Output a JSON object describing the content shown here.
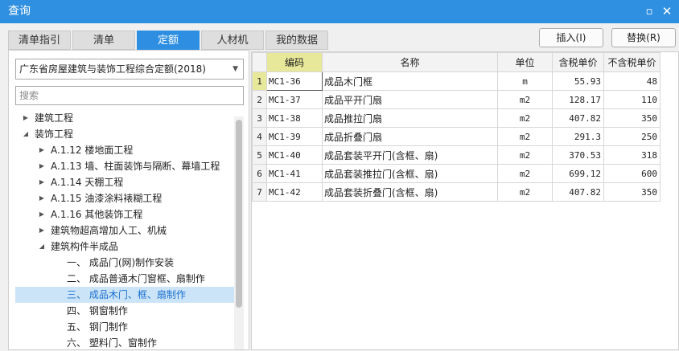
{
  "window": {
    "title": "查询",
    "maximize_glyph": "▫",
    "close_glyph": "✕"
  },
  "tabs": [
    {
      "label": "清单指引",
      "active": false
    },
    {
      "label": "清单",
      "active": false
    },
    {
      "label": "定额",
      "active": true
    },
    {
      "label": "人材机",
      "active": false
    },
    {
      "label": "我的数据",
      "active": false
    }
  ],
  "buttons": {
    "insert": "插入(I)",
    "replace": "替换(R)"
  },
  "library_select": {
    "value": "广东省房屋建筑与装饰工程综合定额(2018)"
  },
  "search": {
    "placeholder": "搜索"
  },
  "tree": [
    {
      "label": "建筑工程",
      "caret": "▶",
      "level": 0
    },
    {
      "label": "装饰工程",
      "caret": "◢",
      "level": 0
    },
    {
      "label": "A.1.12 楼地面工程",
      "caret": "▶",
      "level": 1
    },
    {
      "label": "A.1.13 墙、柱面装饰与隔断、幕墙工程",
      "caret": "▶",
      "level": 1
    },
    {
      "label": "A.1.14 天棚工程",
      "caret": "▶",
      "level": 1
    },
    {
      "label": "A.1.15 油漆涂料裱糊工程",
      "caret": "▶",
      "level": 1
    },
    {
      "label": "A.1.16 其他装饰工程",
      "caret": "▶",
      "level": 1
    },
    {
      "label": "建筑物超高增加人工、机械",
      "caret": "▶",
      "level": 1
    },
    {
      "label": "建筑构件半成品",
      "caret": "◢",
      "level": 1
    },
    {
      "label": "一、 成品门(网)制作安装",
      "caret": "",
      "level": 2
    },
    {
      "label": "二、 成品普通木门窗框、扇制作",
      "caret": "",
      "level": 2
    },
    {
      "label": "三、 成品木门、框、扇制作",
      "caret": "",
      "level": 2,
      "selected": true
    },
    {
      "label": "四、 钢窗制作",
      "caret": "",
      "level": 2
    },
    {
      "label": "五、 钢门制作",
      "caret": "",
      "level": 2
    },
    {
      "label": "六、 塑料门、窗制作",
      "caret": "",
      "level": 2
    }
  ],
  "table": {
    "headers": [
      "",
      "编码",
      "名称",
      "单位",
      "含税单价",
      "不含税单价"
    ],
    "rows": [
      {
        "n": "1",
        "code": "MC1-36",
        "name": "成品木门框",
        "unit": "m",
        "price_tax": "55.93",
        "price_notax": "48"
      },
      {
        "n": "2",
        "code": "MC1-37",
        "name": "成品平开门扇",
        "unit": "m2",
        "price_tax": "128.17",
        "price_notax": "110"
      },
      {
        "n": "3",
        "code": "MC1-38",
        "name": "成品推拉门扇",
        "unit": "m2",
        "price_tax": "407.82",
        "price_notax": "350"
      },
      {
        "n": "4",
        "code": "MC1-39",
        "name": "成品折叠门扇",
        "unit": "m2",
        "price_tax": "291.3",
        "price_notax": "250"
      },
      {
        "n": "5",
        "code": "MC1-40",
        "name": "成品套装平开门(含框、扇)",
        "unit": "m2",
        "price_tax": "370.53",
        "price_notax": "318"
      },
      {
        "n": "6",
        "code": "MC1-41",
        "name": "成品套装推拉门(含框、扇)",
        "unit": "m2",
        "price_tax": "699.12",
        "price_notax": "600"
      },
      {
        "n": "7",
        "code": "MC1-42",
        "name": "成品套装折叠门(含框、扇)",
        "unit": "m2",
        "price_tax": "407.82",
        "price_notax": "350"
      }
    ]
  }
}
